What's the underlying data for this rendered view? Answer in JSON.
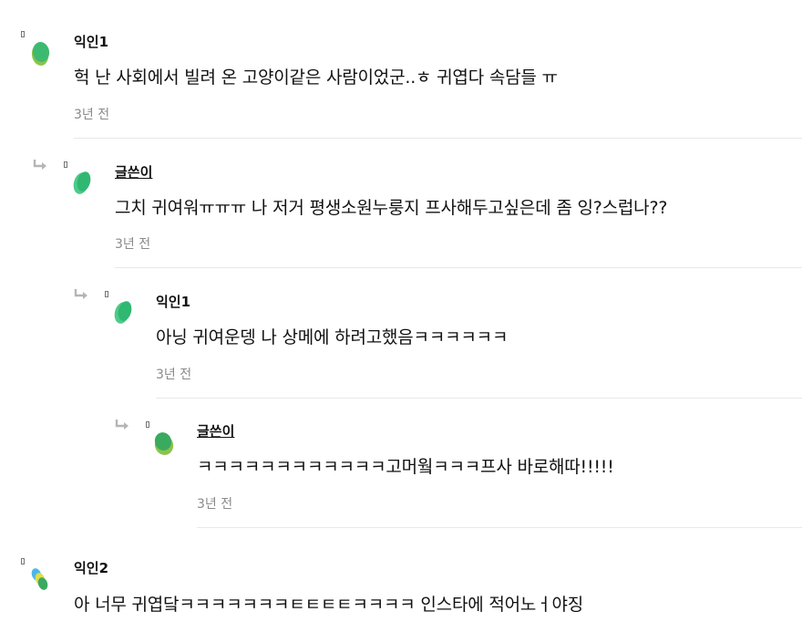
{
  "comments": [
    {
      "author": "익인1",
      "text": "헉 난 사회에서 빌려 온 고양이같은 사람이었군..ㅎ 귀엽다 속담들 ㅠ",
      "time": "3년 전"
    },
    {
      "author": "글쓴이",
      "text": "그치 귀여워ㅠㅠㅠ 나 저거 평생소원누룽지 프사해두고싶은데 좀 잉?스럽나??",
      "time": "3년 전"
    },
    {
      "author": "익인1",
      "text": "아닝 귀여운뎅 나 상메에 하려고했음ㅋㅋㅋㅋㅋㅋ",
      "time": "3년 전"
    },
    {
      "author": "글쓴이",
      "text": "ㅋㅋㅋㅋㅋㅋㅋㅋㅋㅋㅋㅋ고머웤ㅋㅋㅋ프사 바로해따!!!!!",
      "time": "3년 전"
    },
    {
      "author": "익인2",
      "text": "아 너무 귀엽닼ㅋㅋㅋㅋㅋㅋㅋㅌㅌㅌㅌㅋㅋㅋㅋ 인스타에 적어노ㅓ야징",
      "time": ""
    }
  ]
}
